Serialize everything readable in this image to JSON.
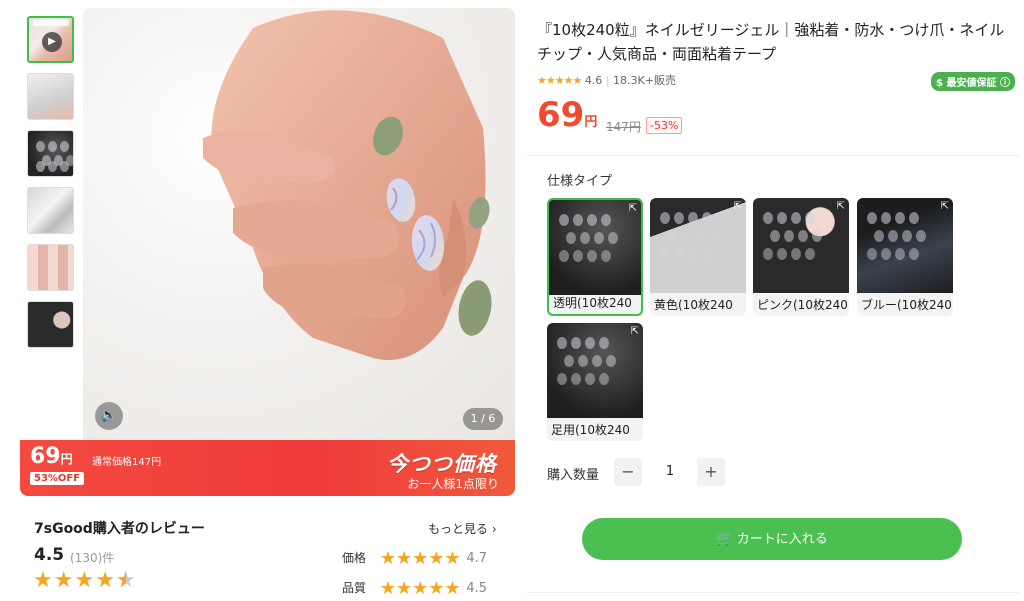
{
  "gallery": {
    "counter": "1 / 6",
    "thumbnails": [
      "video",
      "light",
      "dark",
      "clear",
      "nails",
      "dark2"
    ]
  },
  "promo": {
    "price": "69",
    "yen": "円",
    "regular": "通常価格147円",
    "off": "53%OFF",
    "title": "今つつ価格",
    "limit": "お一人様1点限り"
  },
  "reviews": {
    "title": "7sGood購入者のレビュー",
    "more": "もっと見る",
    "score": "4.5",
    "count": "(130)件",
    "sub": [
      {
        "label": "価格",
        "value": "4.7",
        "stars": "★★★★★"
      },
      {
        "label": "品質",
        "value": "4.5",
        "stars": "★★★★★"
      }
    ]
  },
  "product": {
    "title": "『10枚240粒』ネイルゼリージェル｜強粘着・防水・つけ爪・ネイルチップ・人気商品・両面粘着テープ",
    "rating": "4.6",
    "sold": "18.3K+販売",
    "guarantee": "最安値保証",
    "price": "69",
    "yen": "円",
    "original": "147円",
    "discount": "-53%"
  },
  "spec": {
    "label": "仕様タイプ",
    "options": [
      "透明(10枚240",
      "黄色(10枚240",
      "ピンク(10枚240",
      "ブルー(10枚240",
      "足用(10枚240"
    ]
  },
  "quantity": {
    "label": "購入数量",
    "value": "1",
    "minus": "−",
    "plus": "+"
  },
  "cart": {
    "label": "カートに入れる"
  },
  "colors": {
    "accent": "#4bbf50",
    "price": "#f04b2e",
    "star": "#f5a623",
    "promo": "#ef3b3b"
  }
}
